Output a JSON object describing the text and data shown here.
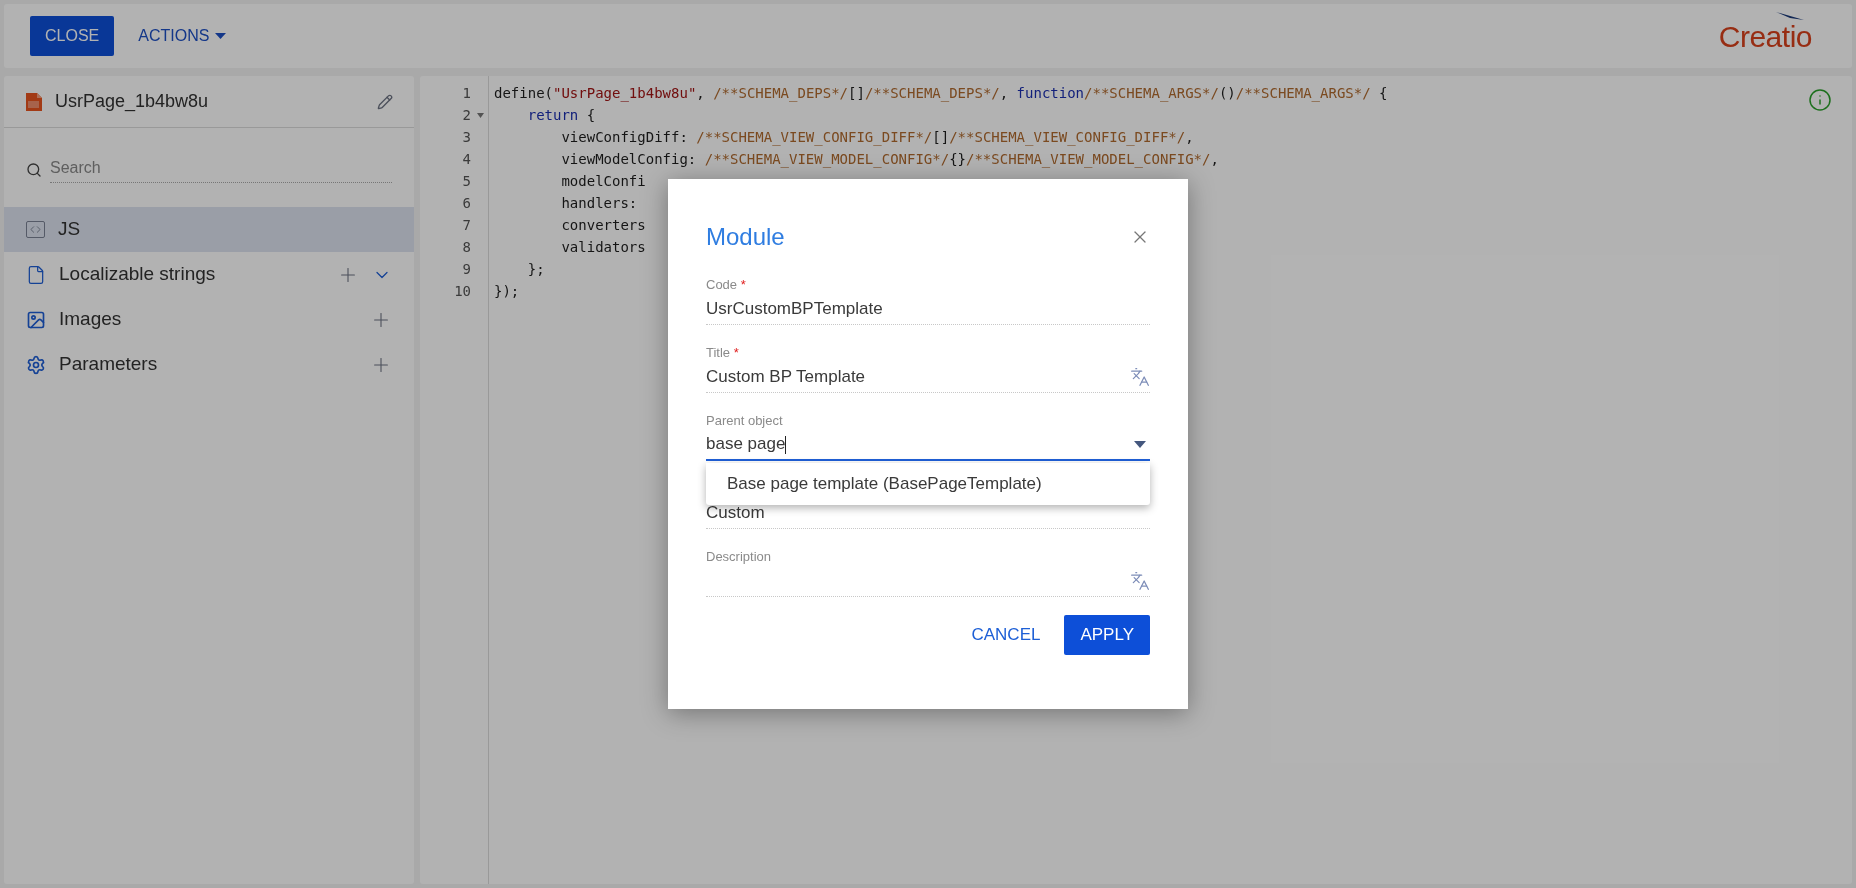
{
  "header": {
    "buttons": [
      {
        "label": "CLOSE",
        "kind": "primary"
      },
      {
        "label": "ACTIONS",
        "kind": "menu"
      }
    ],
    "logo": "Creatio"
  },
  "sidebar": {
    "schema_name": "UsrPage_1b4bw8u",
    "search": {
      "placeholder": "Search"
    },
    "items": [
      {
        "label": "JS",
        "kind": "code",
        "selected": true,
        "addable": false
      },
      {
        "label": "Localizable strings",
        "kind": "file",
        "selected": false,
        "addable": true,
        "expanded": false
      },
      {
        "label": "Images",
        "kind": "image",
        "selected": false,
        "addable": true
      },
      {
        "label": "Parameters",
        "kind": "gear",
        "selected": false,
        "addable": true
      }
    ]
  },
  "editor": {
    "lines": [
      {
        "number": "1",
        "foldable": false,
        "tokens": [
          {
            "t": "define(",
            "kind": "plain"
          },
          {
            "t": "\"UsrPage_1b4bw8u\"",
            "kind": "string"
          },
          {
            "t": ", ",
            "kind": "plain"
          },
          {
            "t": "/**SCHEMA_DEPS*/",
            "kind": "comment"
          },
          {
            "t": "[]",
            "kind": "plain"
          },
          {
            "t": "/**SCHEMA_DEPS*/",
            "kind": "comment"
          },
          {
            "t": ", ",
            "kind": "plain"
          },
          {
            "t": "function",
            "kind": "keyword"
          },
          {
            "t": "/**SCHEMA_ARGS*/",
            "kind": "comment"
          },
          {
            "t": "()",
            "kind": "plain"
          },
          {
            "t": "/**SCHEMA_ARGS*/",
            "kind": "comment"
          },
          {
            "t": " {",
            "kind": "plain"
          }
        ]
      },
      {
        "number": "2",
        "foldable": true,
        "tokens": [
          {
            "t": "    return",
            "kind": "keyword"
          },
          {
            "t": " {",
            "kind": "plain"
          }
        ]
      },
      {
        "number": "3",
        "foldable": false,
        "tokens": [
          {
            "t": "        viewConfigDiff: ",
            "kind": "plain"
          },
          {
            "t": "/**SCHEMA_VIEW_CONFIG_DIFF*/",
            "kind": "comment"
          },
          {
            "t": "[]",
            "kind": "plain"
          },
          {
            "t": "/**SCHEMA_VIEW_CONFIG_DIFF*/",
            "kind": "comment"
          },
          {
            "t": ",",
            "kind": "plain"
          }
        ]
      },
      {
        "number": "4",
        "foldable": false,
        "tokens": [
          {
            "t": "        viewModelConfig: ",
            "kind": "plain"
          },
          {
            "t": "/**SCHEMA_VIEW_MODEL_CONFIG*/",
            "kind": "comment"
          },
          {
            "t": "{}",
            "kind": "plain"
          },
          {
            "t": "/**SCHEMA_VIEW_MODEL_CONFIG*/",
            "kind": "comment"
          },
          {
            "t": ",",
            "kind": "plain"
          }
        ]
      },
      {
        "number": "5",
        "foldable": false,
        "tokens": [
          {
            "t": "        modelConfi",
            "kind": "plain"
          }
        ]
      },
      {
        "number": "6",
        "foldable": false,
        "tokens": [
          {
            "t": "        handlers:",
            "kind": "plain"
          }
        ]
      },
      {
        "number": "7",
        "foldable": false,
        "tokens": [
          {
            "t": "        converters",
            "kind": "plain"
          }
        ]
      },
      {
        "number": "8",
        "foldable": false,
        "tokens": [
          {
            "t": "        validators",
            "kind": "plain"
          }
        ]
      },
      {
        "number": "9",
        "foldable": false,
        "tokens": [
          {
            "t": "    };",
            "kind": "plain"
          }
        ]
      },
      {
        "number": "10",
        "foldable": false,
        "tokens": [
          {
            "t": "});",
            "kind": "plain"
          }
        ]
      }
    ]
  },
  "dialog": {
    "title": "Module",
    "fields": [
      {
        "label": "Code",
        "required_mark": "*",
        "value": "UsrCustomBPTemplate",
        "translatable": false,
        "focused": false,
        "dropdown": false
      },
      {
        "label": "Title",
        "required_mark": "*",
        "value": "Custom BP Template",
        "translatable": true,
        "focused": false,
        "dropdown": false
      },
      {
        "label": "Parent object",
        "value": "base page",
        "translatable": false,
        "focused": true,
        "dropdown": true,
        "options": [
          "Base page template (BasePageTemplate)"
        ]
      },
      {
        "value": "Custom",
        "translatable": false,
        "focused": false,
        "dropdown": false
      },
      {
        "label": "Description",
        "translatable": true,
        "focused": false,
        "dropdown": false
      }
    ],
    "buttons": [
      {
        "label": "CANCEL",
        "kind": "link"
      },
      {
        "label": "APPLY",
        "kind": "primary"
      }
    ]
  }
}
